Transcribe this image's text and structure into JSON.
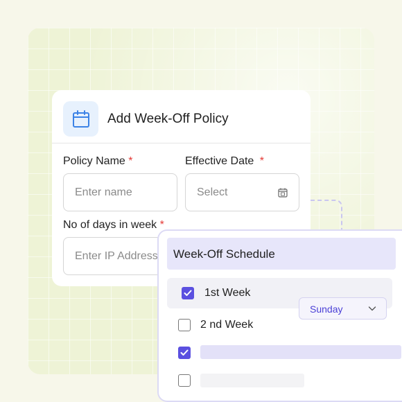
{
  "policy_card": {
    "title": "Add Week-Off Policy",
    "icon": "calendar-icon",
    "policy_name_label": "Policy Name",
    "policy_name_placeholder": "Enter name",
    "effective_date_label": "Effective Date",
    "effective_date_placeholder": "Select",
    "days_label": "No of days in week",
    "days_placeholder": "Enter IP Address",
    "required_mark": "*"
  },
  "schedule": {
    "title": "Week-Off Schedule",
    "rows": [
      {
        "label": "1st Week",
        "checked": true,
        "day": "Sunday"
      },
      {
        "label": "2 nd Week",
        "checked": false
      }
    ]
  },
  "colors": {
    "accent": "#5b50e0",
    "required": "#e53935",
    "icon_blue": "#3b82e6"
  }
}
